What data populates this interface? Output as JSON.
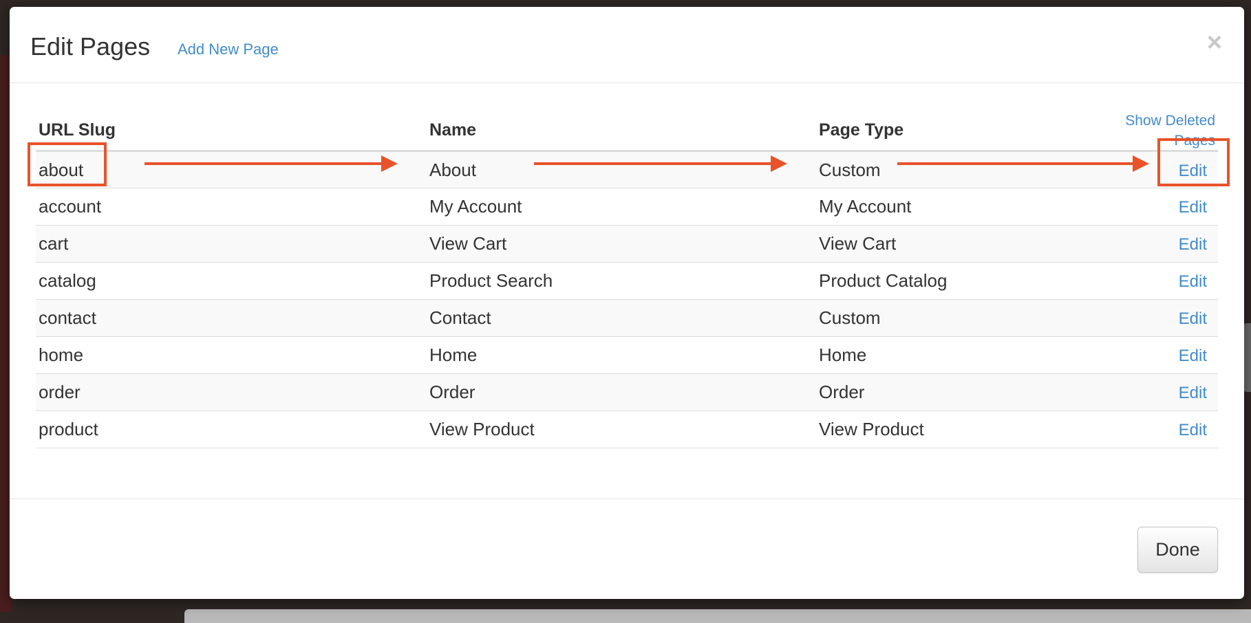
{
  "modal": {
    "title": "Edit Pages",
    "add_link": "Add New Page",
    "close_label": "×",
    "done_label": "Done"
  },
  "table": {
    "columns": [
      "URL Slug",
      "Name",
      "Page Type"
    ],
    "show_deleted": "Show Deleted Pages",
    "edit_label": "Edit",
    "rows": [
      {
        "slug": "about",
        "name": "About",
        "type": "Custom"
      },
      {
        "slug": "account",
        "name": "My Account",
        "type": "My Account"
      },
      {
        "slug": "cart",
        "name": "View Cart",
        "type": "View Cart"
      },
      {
        "slug": "catalog",
        "name": "Product Search",
        "type": "Product Catalog"
      },
      {
        "slug": "contact",
        "name": "Contact",
        "type": "Custom"
      },
      {
        "slug": "home",
        "name": "Home",
        "type": "Home"
      },
      {
        "slug": "order",
        "name": "Order",
        "type": "Order"
      },
      {
        "slug": "product",
        "name": "View Product",
        "type": "View Product"
      }
    ]
  },
  "colors": {
    "link": "#428bca",
    "annotation": "#e8532b"
  },
  "icons": {
    "close": "close-icon"
  }
}
